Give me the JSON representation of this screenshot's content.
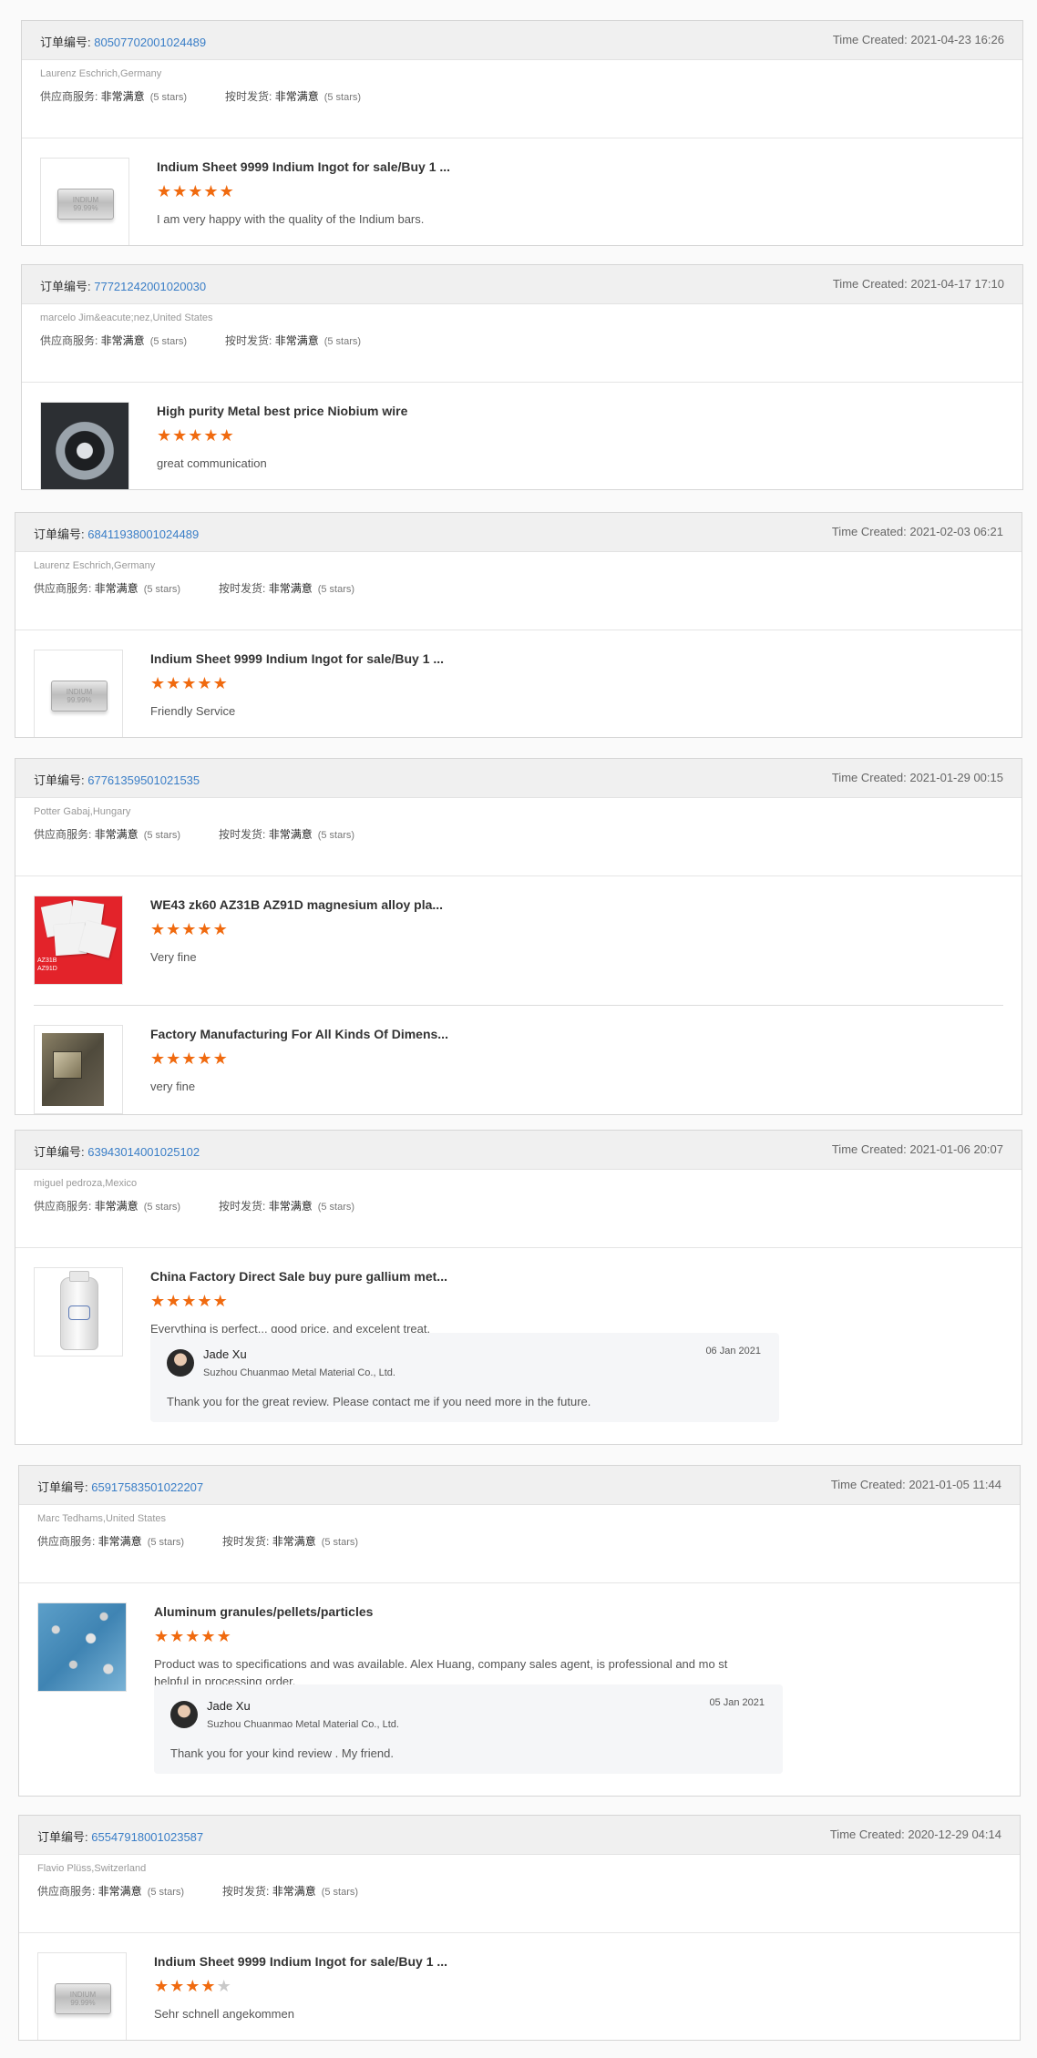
{
  "labels": {
    "order_no": "订单编号: ",
    "time_created": "Time Created: ",
    "supplier_service": "供应商服务: ",
    "on_time_delivery": "按时发货: "
  },
  "orders": [
    {
      "order_id": "80507702001024489",
      "time_created": "2021-04-23 16:26",
      "buyer": "Laurenz Eschrich,Germany",
      "supplier_service_value": "非常满意",
      "supplier_service_stars": "(5 stars)",
      "delivery_value": "非常满意",
      "delivery_stars": "(5 stars)",
      "items": [
        {
          "title": "Indium Sheet 9999 Indium Ingot for sale/Buy 1 ...",
          "rating": 5,
          "review": "I am very happy with the quality of the Indium bars.",
          "image": "indium-ingot"
        }
      ]
    },
    {
      "order_id": "77721242001020030",
      "time_created": "2021-04-17 17:10",
      "buyer": "marcelo Jim&eacute;nez,United States",
      "supplier_service_value": "非常满意",
      "supplier_service_stars": "(5 stars)",
      "delivery_value": "非常满意",
      "delivery_stars": "(5 stars)",
      "items": [
        {
          "title": "High purity Metal best price Niobium wire",
          "rating": 5,
          "review": "great communication",
          "image": "niobium-wire"
        }
      ]
    },
    {
      "order_id": "68411938001024489",
      "time_created": "2021-02-03 06:21",
      "buyer": "Laurenz Eschrich,Germany",
      "supplier_service_value": "非常满意",
      "supplier_service_stars": "(5 stars)",
      "delivery_value": "非常满意",
      "delivery_stars": "(5 stars)",
      "items": [
        {
          "title": "Indium Sheet 9999 Indium Ingot for sale/Buy 1 ...",
          "rating": 5,
          "review": "Friendly Service",
          "image": "indium-ingot"
        }
      ]
    },
    {
      "order_id": "67761359501021535",
      "time_created": "2021-01-29 00:15",
      "buyer": "Potter Gabaj,Hungary",
      "supplier_service_value": "非常满意",
      "supplier_service_stars": "(5 stars)",
      "delivery_value": "非常满意",
      "delivery_stars": "(5 stars)",
      "items": [
        {
          "title": "WE43 zk60 AZ31B AZ91D magnesium alloy pla...",
          "rating": 5,
          "review": "Very fine",
          "image": "magnesium-plates",
          "image_text": [
            "AZ31B",
            "AZ91D"
          ]
        },
        {
          "title": "Factory Manufacturing For All Kinds Of Dimens...",
          "rating": 5,
          "review": "very fine",
          "image": "metal-cube"
        }
      ]
    },
    {
      "order_id": "63943014001025102",
      "time_created": "2021-01-06 20:07",
      "buyer": "miguel pedroza,Mexico",
      "supplier_service_value": "非常满意",
      "supplier_service_stars": "(5 stars)",
      "delivery_value": "非常满意",
      "delivery_stars": "(5 stars)",
      "items": [
        {
          "title": "China Factory Direct Sale buy pure gallium met...",
          "rating": 5,
          "review": "Everything is perfect... good price, and excelent treat.",
          "image": "gallium-bottle",
          "reply": {
            "name": "Jade Xu",
            "company": "Suzhou Chuanmao Metal Material Co., Ltd.",
            "date": "06 Jan 2021",
            "message": "Thank you for the great review. Please contact me if you need more in the future."
          }
        }
      ]
    },
    {
      "order_id": "65917583501022207",
      "time_created": "2021-01-05 11:44",
      "buyer": "Marc Tedhams,United States",
      "supplier_service_value": "非常满意",
      "supplier_service_stars": "(5 stars)",
      "delivery_value": "非常满意",
      "delivery_stars": "(5 stars)",
      "items": [
        {
          "title": "Aluminum granules/pellets/particles",
          "rating": 5,
          "review": "Product was to specifications and was available. Alex Huang, company sales agent, is professional and mo st helpful in processing order.",
          "image": "aluminum-granules",
          "reply": {
            "name": "Jade Xu",
            "company": "Suzhou Chuanmao Metal Material Co., Ltd.",
            "date": "05 Jan 2021",
            "message": "Thank you for your kind review . My friend."
          }
        }
      ]
    },
    {
      "order_id": "65547918001023587",
      "time_created": "2020-12-29 04:14",
      "buyer": "Flavio Plüss,Switzerland",
      "supplier_service_value": "非常满意",
      "supplier_service_stars": "(5 stars)",
      "delivery_value": "非常满意",
      "delivery_stars": "(5 stars)",
      "items": [
        {
          "title": "Indium Sheet 9999 Indium Ingot for sale/Buy 1 ...",
          "rating": 4,
          "review": "Sehr schnell angekommen",
          "image": "indium-ingot"
        }
      ]
    }
  ],
  "colors": {
    "star_on": "#f06a0f",
    "star_off": "#c9c9c9",
    "link": "#3a7ec7"
  }
}
